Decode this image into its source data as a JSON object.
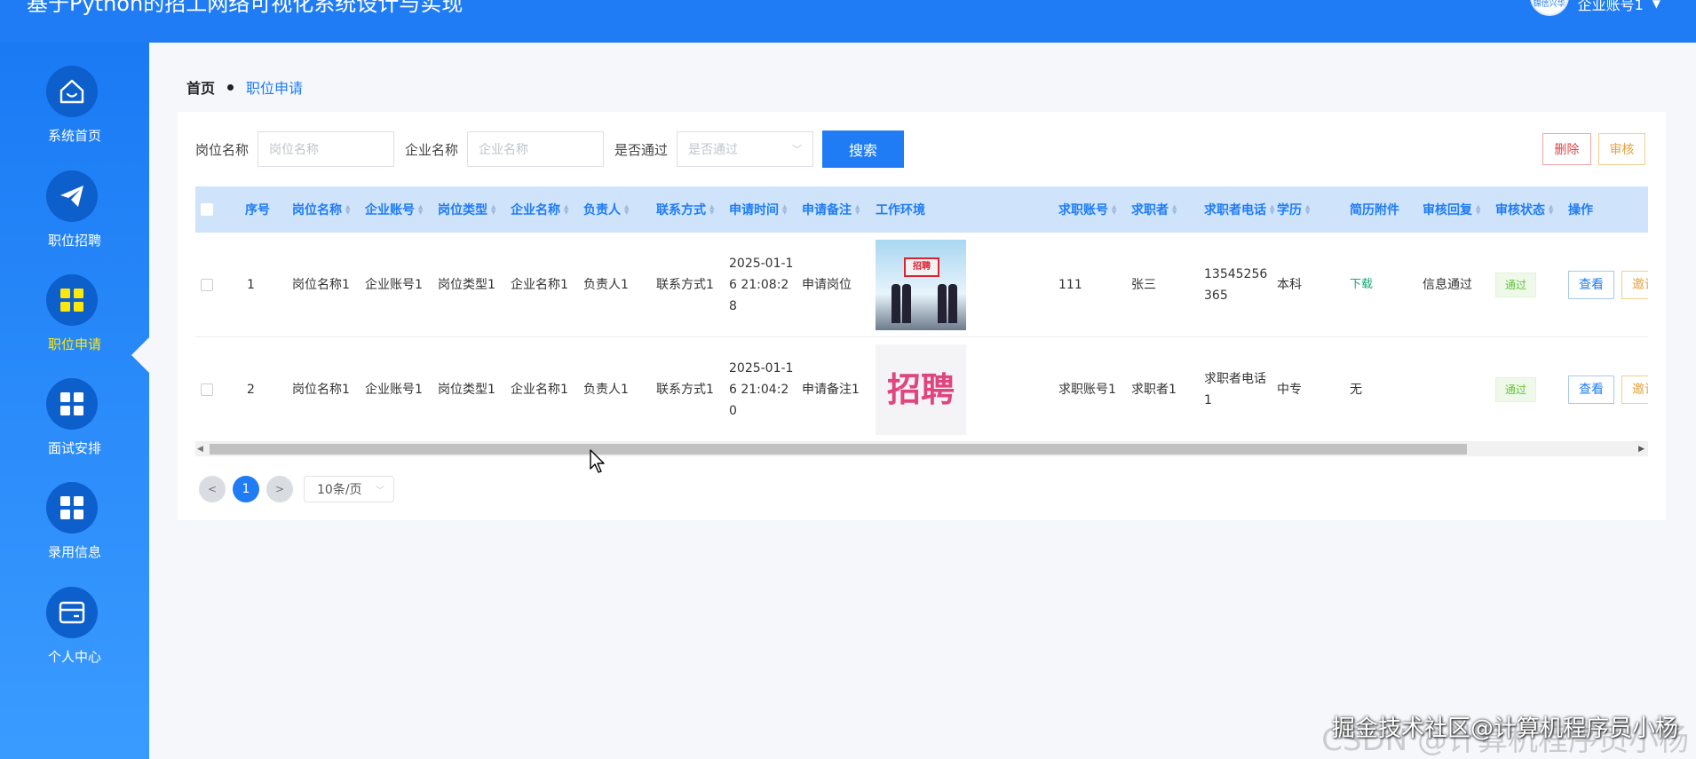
{
  "header": {
    "title": "基于Python的招工网络可视化系统设计与实现",
    "avatar_text": "锦信兴华",
    "user_name": "企业账号1"
  },
  "sidebar": {
    "items": [
      {
        "label": "系统首页",
        "icon": "home-icon"
      },
      {
        "label": "职位招聘",
        "icon": "paper-plane-icon"
      },
      {
        "label": "职位申请",
        "icon": "grid-icon",
        "active": true
      },
      {
        "label": "面试安排",
        "icon": "grid-icon"
      },
      {
        "label": "录用信息",
        "icon": "grid-icon"
      },
      {
        "label": "个人中心",
        "icon": "card-icon"
      }
    ]
  },
  "breadcrumb": {
    "home": "首页",
    "current": "职位申请"
  },
  "filters": {
    "job_name_label": "岗位名称",
    "job_name_placeholder": "岗位名称",
    "company_label": "企业名称",
    "company_placeholder": "企业名称",
    "passed_label": "是否通过",
    "passed_placeholder": "是否通过",
    "search_label": "搜索"
  },
  "actions": {
    "delete_label": "删除",
    "audit_label": "审核"
  },
  "table": {
    "columns": [
      "序号",
      "岗位名称",
      "企业账号",
      "岗位类型",
      "企业名称",
      "负责人",
      "联系方式",
      "申请时间",
      "申请备注",
      "工作环境",
      "求职账号",
      "求职者",
      "求职者电话",
      "学历",
      "简历附件",
      "审核回复",
      "审核状态",
      "操作"
    ],
    "rows": [
      {
        "index": "1",
        "job_name": "岗位名称1",
        "company_account": "企业账号1",
        "job_type": "岗位类型1",
        "company_name": "企业名称1",
        "manager": "负责人1",
        "contact": "联系方式1",
        "apply_time": "2025-01-16 21:08:28",
        "apply_note": "申请岗位",
        "env_image_text": "招聘",
        "seeker_account": "111",
        "seeker": "张三",
        "seeker_phone": "13545256365",
        "education": "本科",
        "resume": "下载",
        "audit_reply": "信息通过",
        "audit_status": "通过",
        "view_label": "查看",
        "invite_label": "邀请"
      },
      {
        "index": "2",
        "job_name": "岗位名称1",
        "company_account": "企业账号1",
        "job_type": "岗位类型1",
        "company_name": "企业名称1",
        "manager": "负责人1",
        "contact": "联系方式1",
        "apply_time": "2025-01-16 21:04:20",
        "apply_note": "申请备注1",
        "env_image_text": "招聘",
        "seeker_account": "求职账号1",
        "seeker": "求职者1",
        "seeker_phone": "求职者电话1",
        "education": "中专",
        "resume": "无",
        "audit_reply": "",
        "audit_status": "通过",
        "view_label": "查看",
        "invite_label": "邀请"
      }
    ]
  },
  "pagination": {
    "prev": "<",
    "current_page": "1",
    "next": ">",
    "page_size": "10条/页"
  },
  "watermark": {
    "text": "掘金技术社区@计算机程序员小杨",
    "background_text": "CSDN @计算机程序员小杨"
  },
  "colors": {
    "primary": "#1f7cf5",
    "active_menu": "#ffe70a",
    "danger": "#e04545",
    "warning": "#e6a23c",
    "success": "#67c23a"
  }
}
